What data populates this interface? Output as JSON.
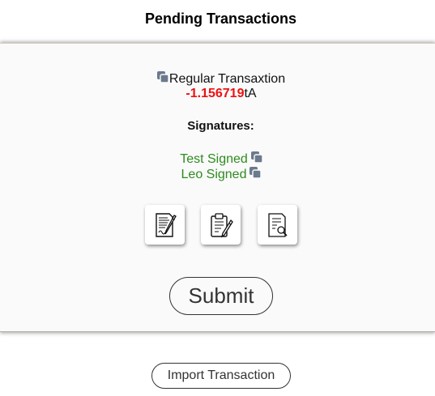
{
  "header": {
    "title": "Pending Transactions"
  },
  "transaction": {
    "type_label": "Regular Transaxtion",
    "amount": "-1.156719",
    "unit": "tA",
    "signatures_heading": "Signatures:",
    "signers": [
      {
        "label": "Test Signed"
      },
      {
        "label": "Leo Signed"
      }
    ]
  },
  "tools": {
    "sign_icon": "sign-document-icon",
    "paste_icon": "clipboard-sign-icon",
    "review_icon": "review-document-icon"
  },
  "actions": {
    "submit_label": "Submit",
    "import_label": "Import Transaction"
  },
  "colors": {
    "amount": "#ee1111",
    "signed": "#2e8b1f",
    "copy_icon": "#6b7a8c"
  }
}
